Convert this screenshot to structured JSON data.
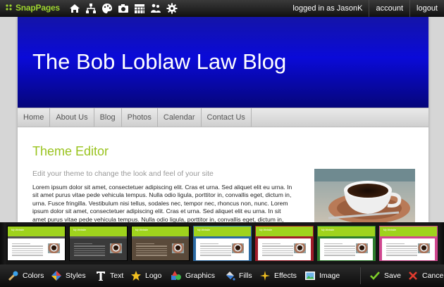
{
  "app": {
    "logo_text": "SnapPages"
  },
  "topbar": {
    "icons": [
      "home-icon",
      "sitemap-icon",
      "palette-icon",
      "camera-icon",
      "calendar-icon",
      "people-icon",
      "settings-icon"
    ],
    "logged_in_text": "logged in as JasonK",
    "account_label": "account",
    "logout_label": "logout"
  },
  "page": {
    "blog_title": "The Bob Loblaw Law Blog",
    "nav": [
      "Home",
      "About Us",
      "Blog",
      "Photos",
      "Calendar",
      "Contact Us"
    ],
    "heading": "Theme Editor",
    "subtitle": "Edit your theme to change the look and feel of your site",
    "body": "Lorem ipsum dolor sit amet, consectetuer adipiscing elit. Cras et urna. Sed aliquet elit eu urna. In sit amet purus vitae pede vehicula tempus. Nulla odio ligula, porttitor in, convallis eget, dictum in, urna. Fusce fringilla. Vestibulum nisi tellus, sodales nec, tempor nec, rhoncus non, nunc. Lorem ipsum dolor sit amet, consectetuer adipiscing elit. Cras et urna. Sed aliquet elit eu urna. In sit amet purus vitae pede vehicula tempus. Nulla odio ligula, porttitor in, convallis eget, dictum in, urna. Fusce"
  },
  "themes": {
    "thumb_title": "My Website",
    "items": [
      {
        "head": "#9fd31d",
        "bg": "#ffffff",
        "line": "#bbbbbb"
      },
      {
        "head": "#9fd31d",
        "bg": "#3a3a3a",
        "line": "#777777"
      },
      {
        "head": "#9fd31d",
        "bg": "#5a4a3a",
        "line": "#9a8a78"
      },
      {
        "head": "#9fd31d",
        "bg": "#ffffff",
        "line": "#bbbbbb",
        "frame": "#2b6aa3"
      },
      {
        "head": "#9fd31d",
        "bg": "#ffffff",
        "line": "#bbbbbb",
        "frame": "#a11c2a"
      },
      {
        "head": "#9fd31d",
        "bg": "#ffffff",
        "line": "#bbbbbb",
        "frame": "#2e7d2e"
      },
      {
        "head": "#9fd31d",
        "bg": "#ffffff",
        "line": "#bbbbbb",
        "frame": "#d0478f"
      }
    ]
  },
  "toolbar": {
    "colors": "Colors",
    "styles": "Styles",
    "text": "Text",
    "logo": "Logo",
    "graphics": "Graphics",
    "fills": "Fills",
    "effects": "Effects",
    "image": "Image",
    "save": "Save",
    "cancel": "Cancel"
  },
  "colors": {
    "accent_green": "#99c31d",
    "banner_blue": "#0a0ad8"
  }
}
